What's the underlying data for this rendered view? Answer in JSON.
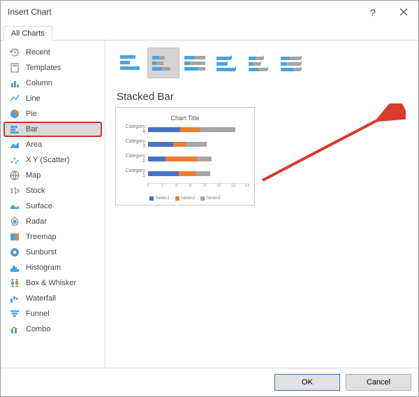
{
  "dialog": {
    "title": "Insert Chart"
  },
  "tab": {
    "label": "All Charts"
  },
  "sidebar": {
    "items": [
      {
        "label": "Recent"
      },
      {
        "label": "Templates"
      },
      {
        "label": "Column"
      },
      {
        "label": "Line"
      },
      {
        "label": "Pie"
      },
      {
        "label": "Bar"
      },
      {
        "label": "Area"
      },
      {
        "label": "X Y (Scatter)"
      },
      {
        "label": "Map"
      },
      {
        "label": "Stock"
      },
      {
        "label": "Surface"
      },
      {
        "label": "Radar"
      },
      {
        "label": "Treemap"
      },
      {
        "label": "Sunburst"
      },
      {
        "label": "Histogram"
      },
      {
        "label": "Box & Whisker"
      },
      {
        "label": "Waterfall"
      },
      {
        "label": "Funnel"
      },
      {
        "label": "Combo"
      }
    ],
    "selected_index": 5
  },
  "section": {
    "title": "Stacked Bar"
  },
  "buttons": {
    "ok": "OK",
    "cancel": "Cancel"
  },
  "chart_data": {
    "type": "bar",
    "orientation": "horizontal",
    "stacked": true,
    "title": "Chart Title",
    "xlabel": "",
    "ylabel": "",
    "xlim": [
      0,
      14
    ],
    "xticks": [
      0,
      2,
      4,
      6,
      8,
      10,
      12,
      14
    ],
    "categories": [
      "Category 4",
      "Category 3",
      "Category 2",
      "Category 1"
    ],
    "series": [
      {
        "name": "Series1",
        "color": "#4472c4",
        "values": [
          4.5,
          3.5,
          2.5,
          4.3
        ]
      },
      {
        "name": "Series2",
        "color": "#ed7d31",
        "values": [
          2.8,
          1.8,
          4.5,
          2.5
        ]
      },
      {
        "name": "Series3",
        "color": "#a5a5a5",
        "values": [
          5.0,
          3.0,
          2.0,
          2.0
        ]
      }
    ]
  }
}
